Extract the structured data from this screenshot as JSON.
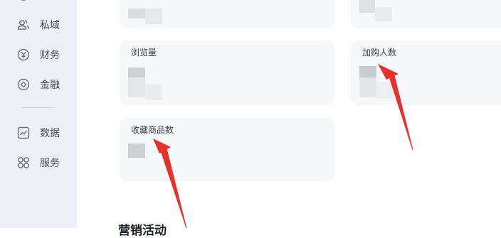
{
  "sidebar": {
    "items": [
      {
        "label": "私域",
        "icon": "users-icon"
      },
      {
        "label": "财务",
        "icon": "yuan-icon"
      },
      {
        "label": "金融",
        "icon": "diamond-icon"
      },
      {
        "label": "数据",
        "icon": "chart-icon"
      },
      {
        "label": "服务",
        "icon": "grid-icon"
      }
    ]
  },
  "cards": {
    "browse_label": "浏览量",
    "add_cart_label": "加购人数",
    "favorite_label": "收藏商品数"
  },
  "section": {
    "title": "营销活动"
  },
  "colors": {
    "sidebar_bg": "#eef0f8",
    "card_bg": "#f6f7f9",
    "arrow": "#e8302a"
  }
}
